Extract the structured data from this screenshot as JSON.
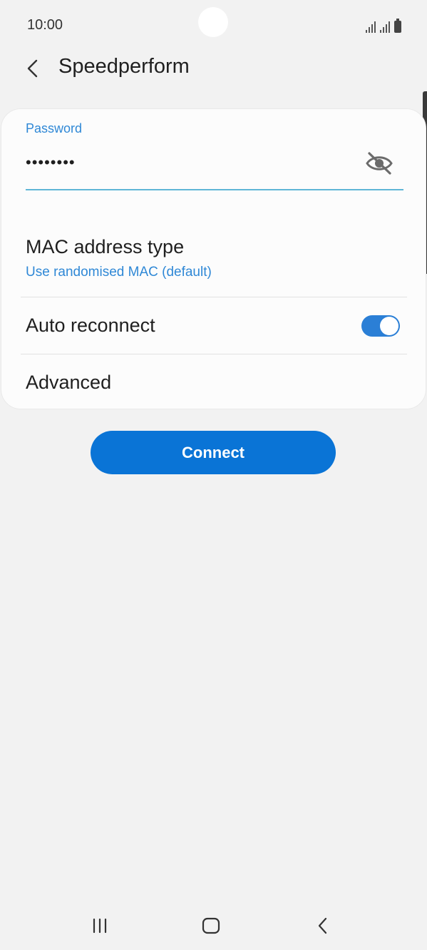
{
  "status_bar": {
    "time": "10:00",
    "signal_icon": "signal-icon",
    "battery_icon": "battery-icon"
  },
  "header": {
    "title": "Speedperform",
    "back_icon": "back-arrow-icon"
  },
  "password": {
    "label": "Password",
    "value": "••••••••",
    "visibility_icon": "eye-off-icon"
  },
  "mac": {
    "title": "MAC address type",
    "value": "Use randomised MAC (default)"
  },
  "auto_reconnect": {
    "label": "Auto reconnect",
    "enabled": true
  },
  "advanced": {
    "label": "Advanced"
  },
  "connect": {
    "label": "Connect"
  },
  "nav": {
    "recents_icon": "recents-icon",
    "home_icon": "home-icon",
    "back_icon": "back-icon"
  },
  "colors": {
    "accent": "#0a74d6",
    "link": "#2f88d6",
    "background": "#f2f2f2",
    "card": "#fcfcfc"
  }
}
